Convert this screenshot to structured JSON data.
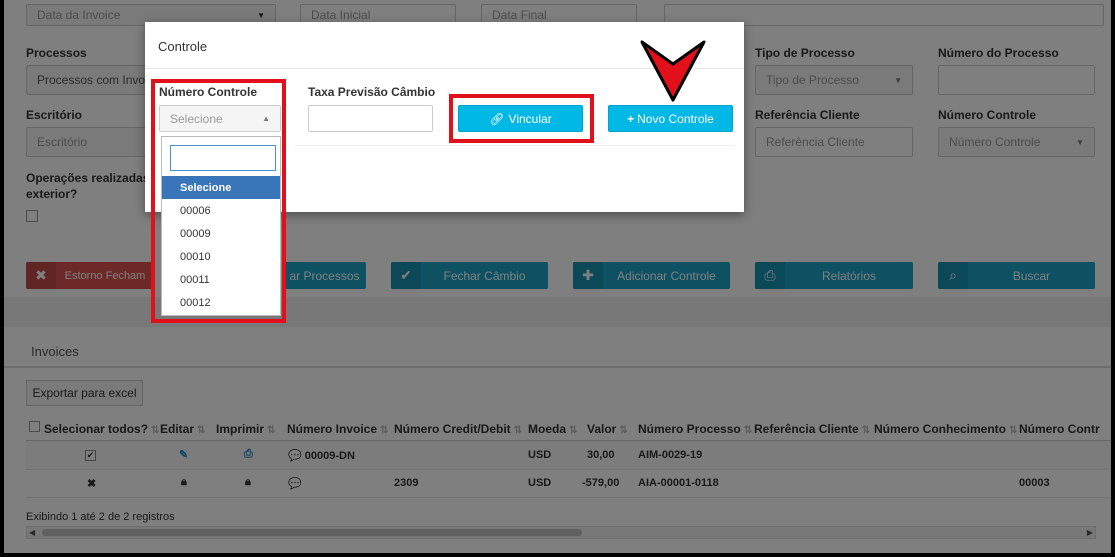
{
  "filters": {
    "data_invoice": "Data da Invoice",
    "data_inicial": "Data Inicial",
    "data_final": "Data Final"
  },
  "form": {
    "processos_label": "Processos",
    "processos_value": "Processos com Invoi",
    "escritorio_label": "Escritório",
    "escritorio_value": "Escritório",
    "operacoes_label_1": "Operações realizadas n",
    "operacoes_label_2": "exterior?",
    "tipo_processo_label": "Tipo de Processo",
    "tipo_processo_value": "Tipo de Processo",
    "numero_processo_label": "Número do Processo",
    "referencia_cliente_label": "Referência Cliente",
    "referencia_cliente_placeholder": "Referência Cliente",
    "numero_controle_label": "Número Controle",
    "numero_controle_value": "Número Controle"
  },
  "actions": {
    "estorno": "Estorno Fecham",
    "processos": "ar Processos",
    "fechar_cambio": "Fechar Câmbio",
    "adicionar_controle": "Adicionar Controle",
    "relatorios": "Relatórios",
    "buscar": "Buscar"
  },
  "invoices": {
    "title": "Invoices",
    "export_label": "Exportar para excel",
    "columns": [
      "Selecionar todos?",
      "Editar",
      "Imprimir",
      "Número Invoice",
      "Número Credit/Debit",
      "Moeda",
      "Valor",
      "Número Processo",
      "Referência Cliente",
      "Número Conhecimento",
      "Número Contr"
    ],
    "rows": [
      {
        "numero_invoice": "00009-DN",
        "credit_debit": "",
        "moeda": "USD",
        "valor": "30,00",
        "processo": "AIM-0029-19",
        "conhecimento": "",
        "controle": ""
      },
      {
        "numero_invoice": "",
        "credit_debit": "2309",
        "moeda": "USD",
        "valor": "-579,00",
        "processo": "AIA-00001-0118",
        "conhecimento": "",
        "controle": "00003"
      }
    ],
    "footer": "Exibindo 1 até 2 de 2 registros"
  },
  "modal": {
    "title": "Controle",
    "numero_controle_label": "Número Controle",
    "select_value": "Selecione",
    "taxa_label": "Taxa Previsão Câmbio",
    "vincular_label": "Vincular",
    "novo_controle_label": "Novo Controle",
    "options": [
      "Selecione",
      "00006",
      "00009",
      "00010",
      "00011",
      "00012"
    ]
  },
  "colors": {
    "highlight": "#e2101b",
    "teal": "#1aa3c7",
    "cyan": "#00b8e6",
    "danger": "#d9534f",
    "option_active": "#3875b9"
  }
}
